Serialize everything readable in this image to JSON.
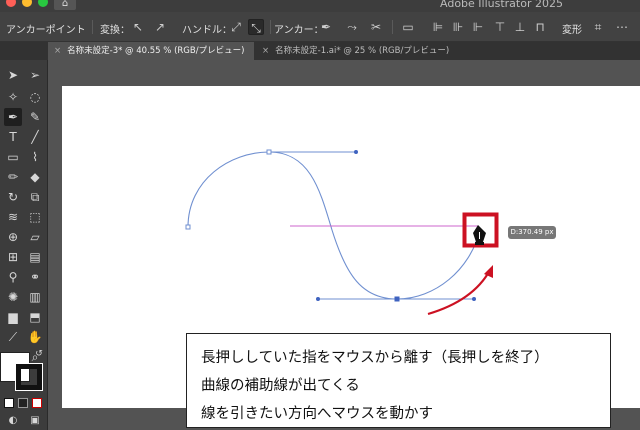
{
  "window": {
    "app_title": "Adobe Illustrator 2025",
    "home_glyph": "⌂"
  },
  "controlbar": {
    "anchor_point_label": "アンカーポイント",
    "convert_label": "変換：",
    "handle_label": "ハンドル：",
    "anchor_label": "アンカー：",
    "transform_label": "変形"
  },
  "tabs": [
    {
      "label": "名称未設定-3* @ 40.55 % (RGB/プレビュー)",
      "close": "×"
    },
    {
      "label": "名称未設定-1.ai* @ 25 % (RGB/プレビュー)",
      "close": "×"
    }
  ],
  "tooltip": {
    "distance": "D:370.49 px"
  },
  "callout": {
    "lines": [
      "長押ししていた指をマウスから離す（長押しを終了）",
      "曲線の補助線が出てくる",
      "線を引きたい方向へマウスを動かす"
    ]
  },
  "colors": {
    "path": "#6f8fd0",
    "guide": "#cc66cc",
    "highlight_box": "#cc1122",
    "arrow": "#cc1122"
  },
  "icons": {
    "selection": "selection-arrow-icon",
    "pen": "pen-tool-icon",
    "type": "type-tool-icon",
    "zoom": "zoom-icon",
    "hand": "hand-icon"
  }
}
